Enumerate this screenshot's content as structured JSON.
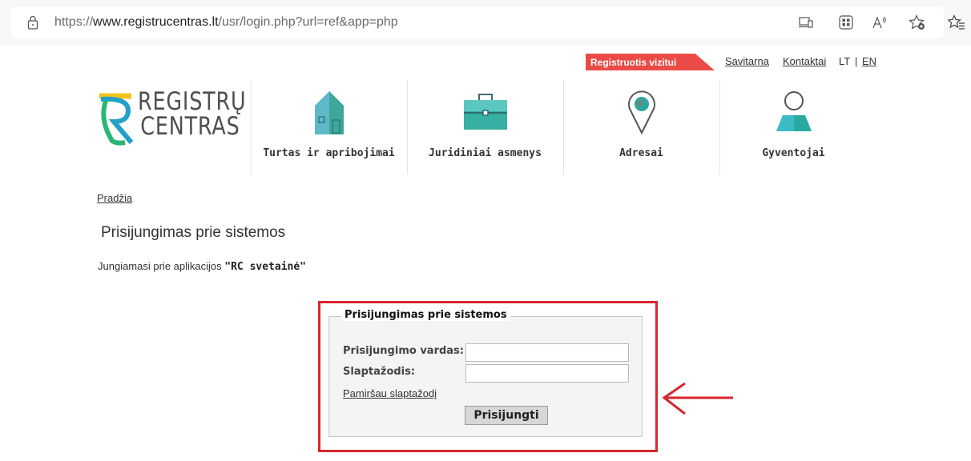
{
  "browser": {
    "url_prefix": "https://",
    "url_host": "www.registrucentras.lt",
    "url_path": "/usr/login.php?url=ref&app=php",
    "icons": [
      "lock-icon",
      "device-icon",
      "app-grid-icon",
      "read-aloud-icon",
      "favorite-add-icon",
      "favorites-list-icon"
    ]
  },
  "header": {
    "register_visit_label": "Registruotis vizitui",
    "links": {
      "self_service": "Savitarna",
      "contacts": "Kontaktai",
      "lang_lt": "LT",
      "lang_sep": "|",
      "lang_en": "EN"
    },
    "logo": {
      "line1": "REGISTRŲ",
      "line2": "CENTRAS"
    },
    "nav": [
      {
        "label": "Turtas ir apribojimai",
        "icon": "house-icon"
      },
      {
        "label": "Juridiniai asmenys",
        "icon": "briefcase-icon"
      },
      {
        "label": "Adresai",
        "icon": "map-pin-icon"
      },
      {
        "label": "Gyventojai",
        "icon": "person-icon"
      }
    ]
  },
  "breadcrumb": "Pradžia",
  "page_title": "Prisijungimas prie sistemos",
  "connecting": {
    "prefix": "Jungiamasi prie aplikacijos",
    "app": "\"RC svetainė\""
  },
  "login_form": {
    "legend": "Prisijungimas prie sistemos",
    "username_label": "Prisijungimo vardas:",
    "username_value": "",
    "password_label": "Slaptažodis:",
    "password_value": "",
    "forgot_link": "Pamiršau slaptažodį",
    "submit_label": "Prisijungti"
  },
  "colors": {
    "accent_red": "#ea4b47",
    "highlight_red": "#d7262e",
    "teal": "#2aa9a0",
    "logo_gray": "#4d4f55"
  }
}
